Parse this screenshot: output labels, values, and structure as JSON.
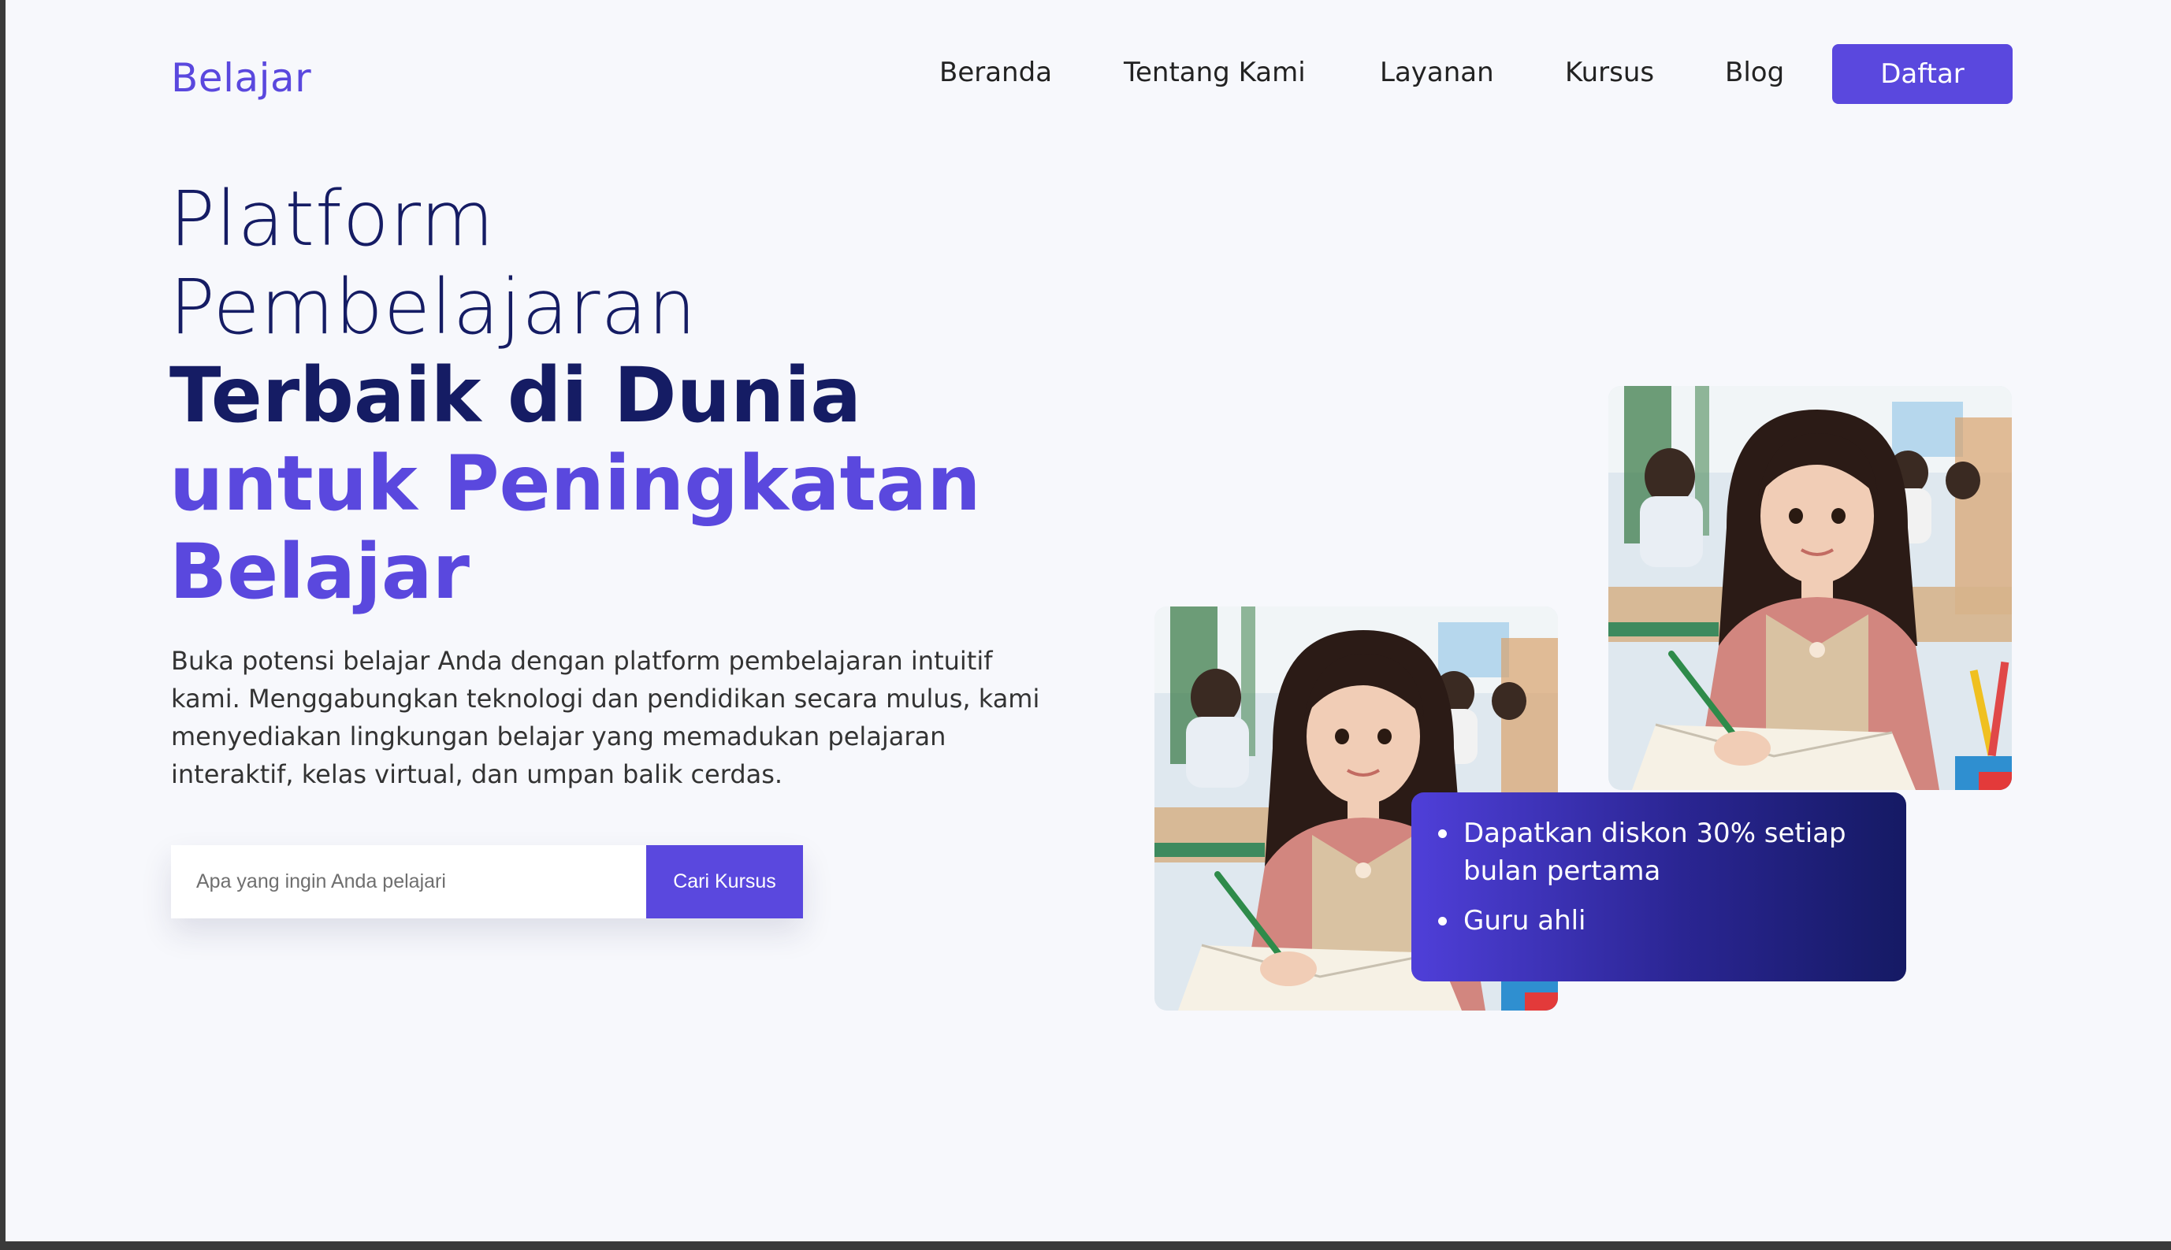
{
  "brand": {
    "name": "Belajar",
    "primary_color": "#5a48de",
    "dark_color": "#151c64"
  },
  "nav": {
    "links": [
      "Beranda",
      "Tentang Kami",
      "Layanan",
      "Kursus",
      "Blog"
    ],
    "cta_label": "Daftar"
  },
  "hero": {
    "title_line1": "Platform",
    "title_line2": "Pembelajaran",
    "title_line3": "Terbaik di Dunia",
    "title_line4": "untuk Peningkatan",
    "title_line5": "Belajar",
    "description": "Buka potensi belajar Anda dengan platform pembelajaran intuitif kami. Menggabungkan teknologi dan pendidikan secara mulus, kami menyediakan lingkungan belajar yang memadukan pelajaran interaktif, kelas virtual, dan umpan balik cerdas."
  },
  "search": {
    "placeholder": "Apa yang ingin Anda pelajari",
    "button_label": "Cari Kursus"
  },
  "promo": {
    "items": [
      "Dapatkan diskon 30% setiap bulan pertama",
      "Guru ahli"
    ]
  }
}
